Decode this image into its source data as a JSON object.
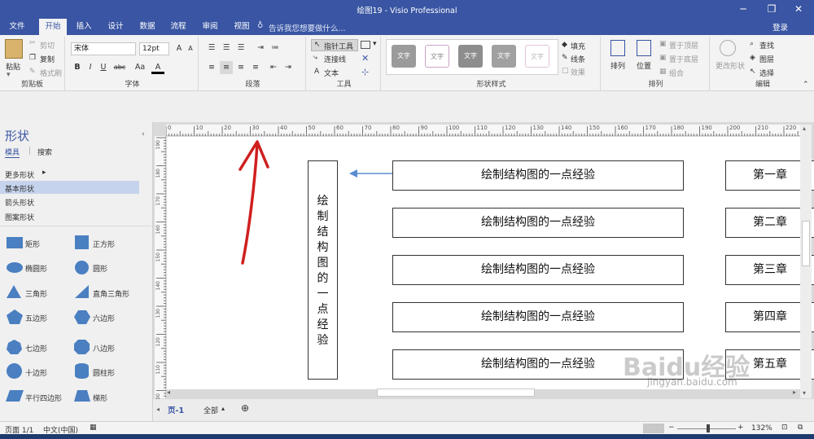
{
  "window": {
    "title": "绘图19 - Visio Professional",
    "login": "登录",
    "tellme": "告诉我您想要做什么..."
  },
  "tabs": [
    "文件",
    "开始",
    "插入",
    "设计",
    "数据",
    "流程",
    "审阅",
    "视图"
  ],
  "ribbon": {
    "clipboard": {
      "paste": "粘贴",
      "cut": "剪切",
      "copy": "复制",
      "format_painter": "格式刷",
      "label": "剪贴板"
    },
    "font": {
      "family": "宋体",
      "size": "12pt",
      "label": "字体",
      "bold": "B",
      "italic": "I",
      "underline": "U",
      "strike": "abc",
      "case": "Aa"
    },
    "paragraph": {
      "label": "段落"
    },
    "tools": {
      "pointer": "指针工具",
      "connector": "连接线",
      "text": "文本",
      "label": "工具"
    },
    "shape_styles": {
      "label": "形状样式",
      "sample": "文字",
      "fill": "填充",
      "line": "线条",
      "effects": "效果"
    },
    "arrange": {
      "align": "排列",
      "position": "位置",
      "bring_front": "置于顶层",
      "send_back": "置于底层",
      "group": "组合",
      "label": "排列"
    },
    "editing": {
      "change_shape": "更改形状",
      "find": "查找",
      "layers": "图层",
      "select": "选择",
      "label": "编辑"
    }
  },
  "sidebar": {
    "title": "形状",
    "tabs": [
      "模具",
      "搜索"
    ],
    "items": [
      "更多形状",
      "基本形状",
      "箭头形状",
      "图案形状"
    ],
    "shapes": [
      [
        "矩形",
        "正方形"
      ],
      [
        "椭圆形",
        "圆形"
      ],
      [
        "三角形",
        "直角三角形"
      ],
      [
        "五边形",
        "六边形"
      ],
      [
        "七边形",
        "八边形"
      ],
      [
        "十边形",
        "圆柱形"
      ],
      [
        "平行四边形",
        "梯形"
      ]
    ]
  },
  "ruler": {
    "h_ticks": [
      "0",
      "10",
      "20",
      "30",
      "40",
      "50",
      "60",
      "70",
      "80",
      "90",
      "100",
      "110",
      "120",
      "130",
      "140",
      "150",
      "160",
      "170",
      "180",
      "190",
      "200",
      "210",
      "220"
    ],
    "v_ticks": [
      "190",
      "180",
      "170",
      "160",
      "150",
      "140",
      "130",
      "120",
      "110",
      "100"
    ]
  },
  "diagram": {
    "vertical_chars": [
      "绘",
      "制",
      "结",
      "构",
      "图",
      "的",
      "一",
      "点",
      "经",
      "验"
    ],
    "rows": [
      "绘制结构图的一点经验",
      "绘制结构图的一点经验",
      "绘制结构图的一点经验",
      "绘制结构图的一点经验",
      "绘制结构图的一点经验"
    ],
    "chapters": [
      "第一章",
      "第二章",
      "第三章",
      "第四章",
      "第五章"
    ]
  },
  "pagebar": {
    "page": "页-1",
    "all": "全部",
    "add": "⊕"
  },
  "status": {
    "page": "页面 1/1",
    "lang": "中文(中国)",
    "zoom": "132%"
  },
  "watermark": {
    "text": "Baidu经验",
    "url": "jingyan.baidu.com"
  },
  "colors": {
    "accent": "#3955a3",
    "annotation": "#d01f1f"
  }
}
